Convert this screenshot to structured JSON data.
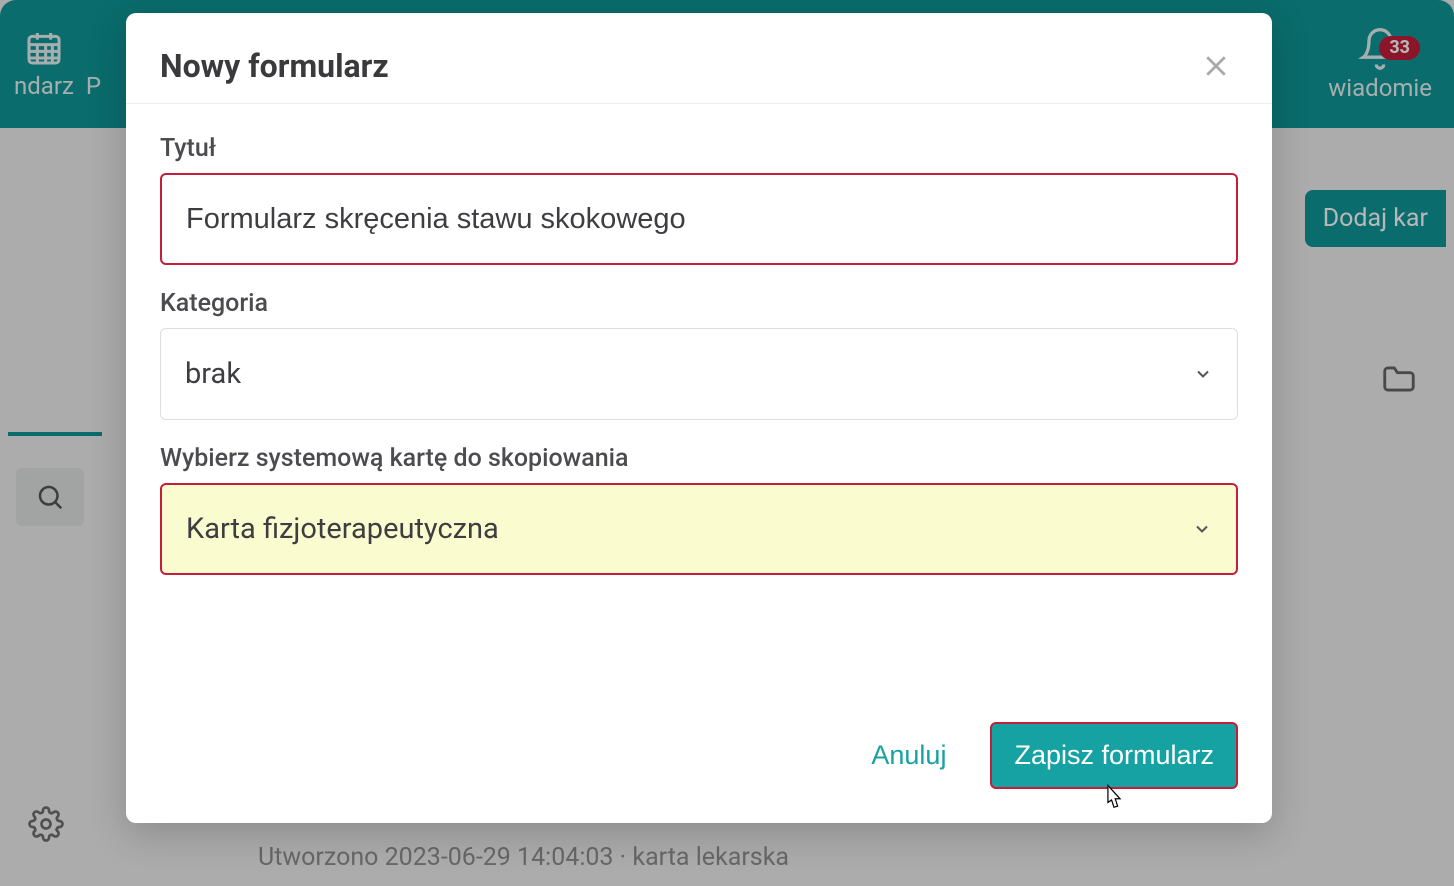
{
  "topbar": {
    "item_left_label": "ndarz",
    "item_left2": "P",
    "item_right_label": "wiadomie",
    "badge": "33"
  },
  "bg": {
    "add_card_label": "Dodaj kar",
    "bottom_text": "Utworzono 2023-06-29 14:04:03 · karta lekarska"
  },
  "modal": {
    "title": "Nowy formularz",
    "fields": {
      "title_label": "Tytuł",
      "title_value": "Formularz skręcenia stawu skokowego",
      "category_label": "Kategoria",
      "category_value": "brak",
      "copy_label": "Wybierz systemową kartę do skopiowania",
      "copy_value": "Karta fizjoterapeutyczna"
    },
    "cancel_label": "Anuluj",
    "save_label": "Zapisz formularz"
  }
}
